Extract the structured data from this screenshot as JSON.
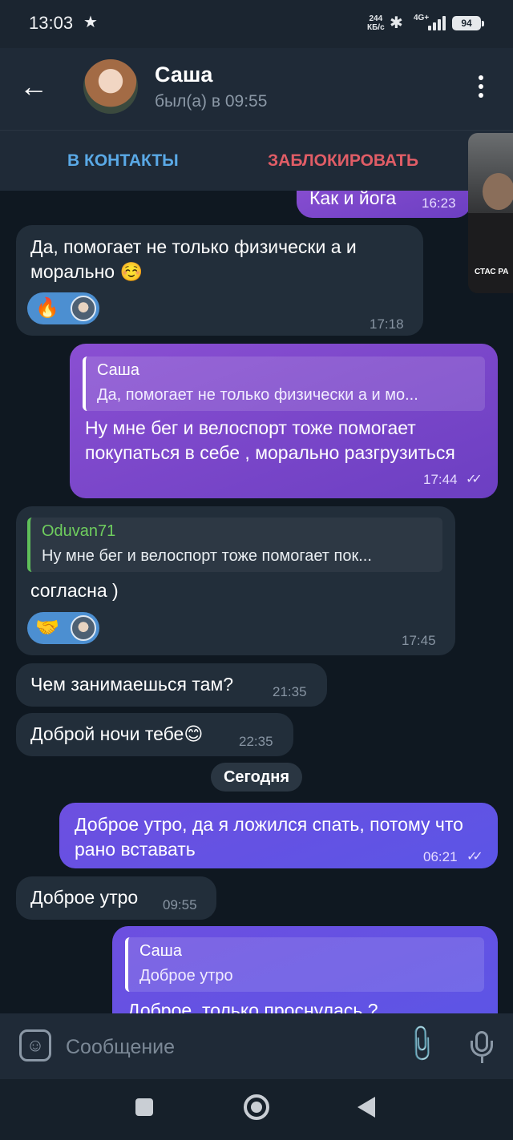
{
  "status_bar": {
    "time": "13:03",
    "star": "★",
    "net_speed": "244",
    "net_unit": "КБ/с",
    "network": "4G+",
    "battery": "94"
  },
  "header": {
    "back": "←",
    "title": "Саша",
    "subtitle": "был(а) в 09:55",
    "menu_icon": "more-vert-icon"
  },
  "actions": {
    "add_contact": "В КОНТАКТЫ",
    "block": "ЗАБЛОКИРОВАТЬ"
  },
  "pip": {
    "label": "СТАС РА"
  },
  "messages": [
    {
      "text": "Как и йога",
      "time": "16:23",
      "dir": "out"
    },
    {
      "text": "Да, помогает не только физически а и морально ☺️",
      "time": "17:18",
      "dir": "in",
      "reaction": "🔥"
    },
    {
      "reply_name": "Саша",
      "reply_text": "Да, помогает не только физически а и мо...",
      "text": "Ну мне бег и велоспорт тоже помогает покупаться в себе , морально разгрузиться",
      "time": "17:44",
      "dir": "out"
    },
    {
      "reply_name": "Oduvan71",
      "reply_text": "Ну мне бег и велоспорт тоже помогает пок...",
      "text": "согласна )",
      "time": "17:45",
      "dir": "in",
      "reaction": "🤝"
    },
    {
      "text": "Чем занимаешься там?",
      "time": "21:35",
      "dir": "in"
    },
    {
      "text": "Доброй ночи тебе😊",
      "time": "22:35",
      "dir": "in"
    },
    {
      "text": "Доброе утро, да я ложился спать, потому что рано вставать",
      "time": "06:21",
      "dir": "out"
    },
    {
      "text": "Доброе утро",
      "time": "09:55",
      "dir": "in"
    },
    {
      "reply_name": "Саша",
      "reply_text": "Доброе утро",
      "text": "Доброе, только проснулась ?",
      "dir": "out"
    }
  ],
  "date_separator": "Сегодня",
  "ticks": "✓✓",
  "input": {
    "placeholder": "Сообщение",
    "emoji_icon": "☺",
    "attach_icon": "📎"
  },
  "colors": {
    "accent_blue": "#5aa9e6",
    "danger_red": "#e05d66",
    "outgoing_violet": "#7a46c8",
    "outgoing_blue": "#5e55e4",
    "incoming": "#222e3a"
  }
}
